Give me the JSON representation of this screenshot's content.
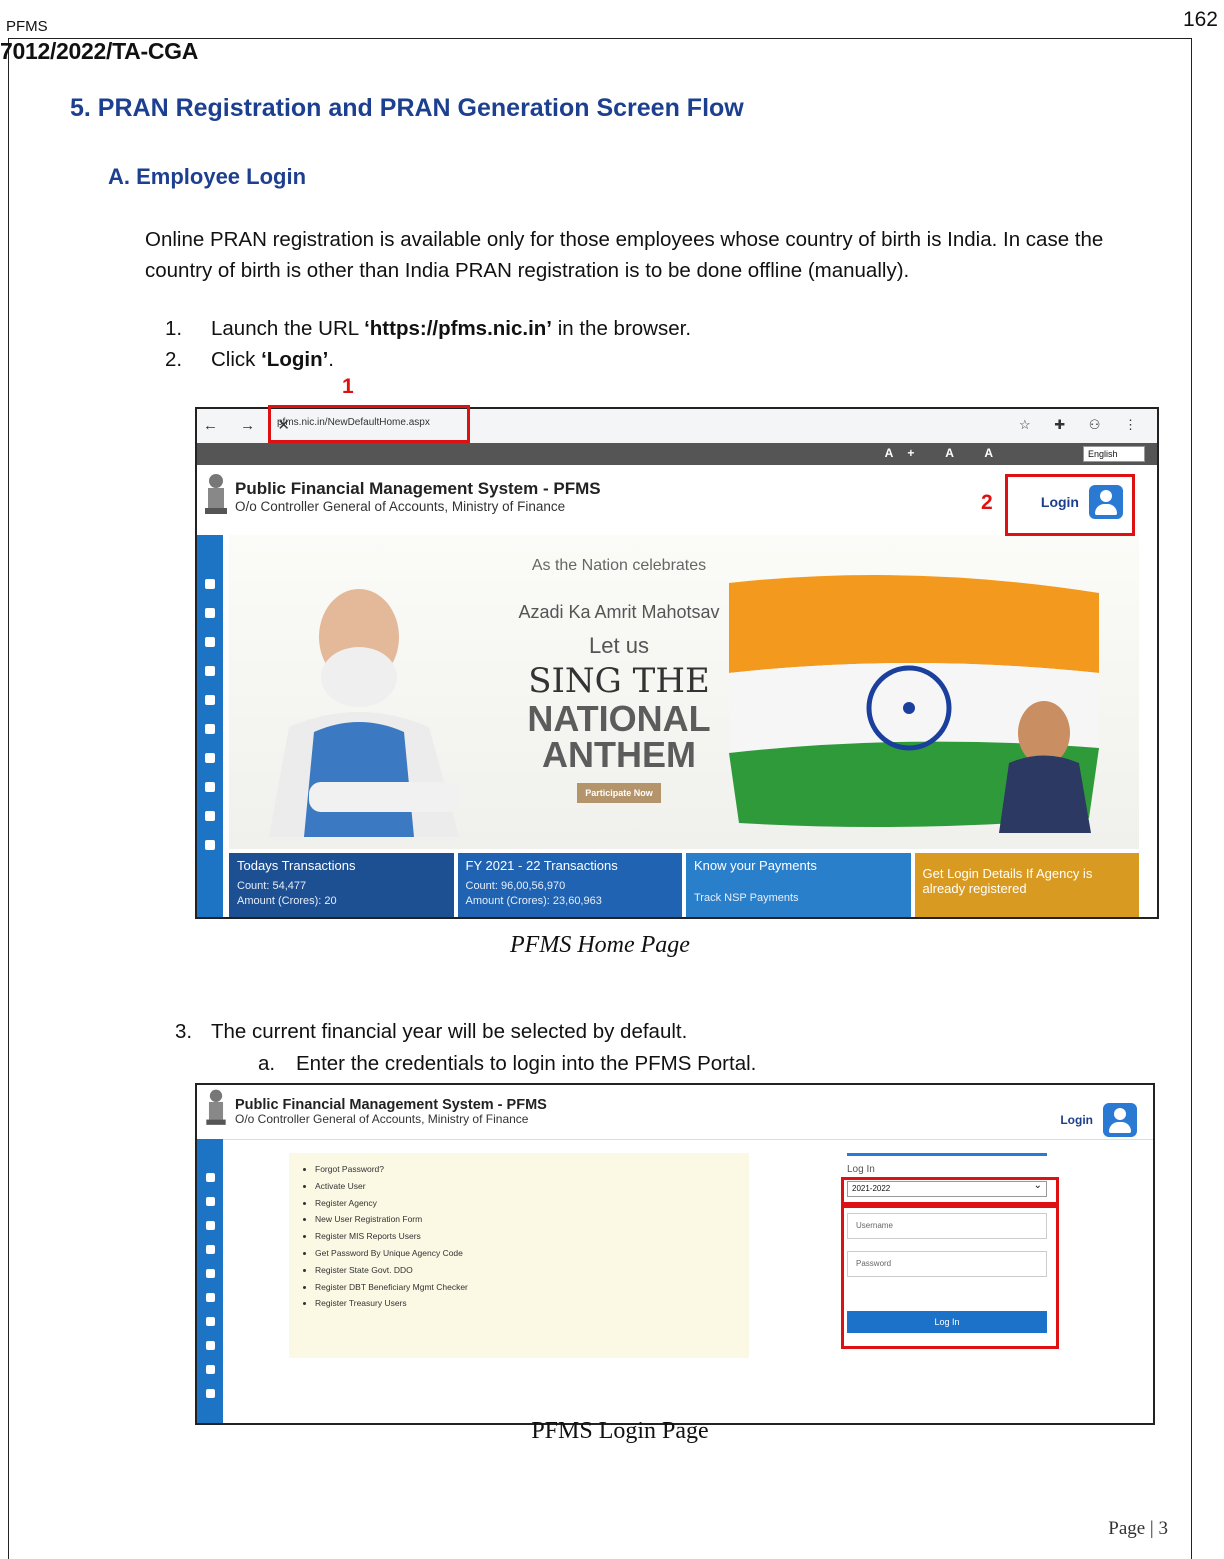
{
  "header": {
    "left": "PFMS",
    "ref": "7012/2022/TA-CGA",
    "page_number": "162"
  },
  "section": {
    "heading": "5.  PRAN Registration and PRAN Generation Screen Flow",
    "subheading": "A.  Employee Login",
    "intro": "Online PRAN registration is available only for those employees whose country of birth is India. In case the country of birth is other than India PRAN registration is to be done offline (manually).",
    "steps": [
      {
        "num": "1.",
        "pre": "Launch the URL ",
        "bold": "‘https://pfms.nic.in’",
        "post": " in the browser."
      },
      {
        "num": "2.",
        "pre": "Click ",
        "bold": "‘Login’",
        "post": "."
      },
      {
        "num": "3.",
        "pre": "The current financial year will be selected by default.",
        "bold": "",
        "post": ""
      }
    ],
    "substep": {
      "num": "a.",
      "text": "Enter the  credentials to login into the PFMS Portal."
    },
    "markers": [
      "1",
      "2"
    ]
  },
  "home_screenshot": {
    "url": "pfms.nic.in/NewDefaultHome.aspx",
    "nav_icons": "← → ✕",
    "browser_icons": "☆ ✚ ⚇ ⋮",
    "access_buttons": "A+ A A",
    "language": "English",
    "title": "Public Financial Management System - PFMS",
    "subtitle": "O/o Controller General of Accounts, Ministry of Finance",
    "login_label": "Login",
    "banner": {
      "line1": "As the Nation celebrates",
      "line2": "Azadi Ka Amrit Mahotsav",
      "line3": "Let us",
      "line4": "SING THE",
      "line5": "NATIONAL",
      "line6": "ANTHEM",
      "cta": "Participate Now"
    },
    "tiles": [
      {
        "title": "Todays Transactions",
        "l1": "Count: 54,477",
        "l2": "Amount (Crores): 20",
        "color": "#1d4f93"
      },
      {
        "title": "FY 2021 - 22 Transactions",
        "l1": "Count: 96,00,56,970",
        "l2": "Amount (Crores): 23,60,963",
        "color": "#1f63b2"
      },
      {
        "title": "Know your Payments",
        "l1": "",
        "l2": "Track NSP Payments",
        "color": "#2a7fcb"
      },
      {
        "title": "Get Login Details If Agency is already registered",
        "l1": "",
        "l2": "",
        "color": "#d99a22"
      }
    ],
    "caption": "PFMS Home Page"
  },
  "login_screenshot": {
    "title": "Public Financial Management System - PFMS",
    "subtitle": "O/o Controller General of Accounts, Ministry of Finance",
    "login_label": "Login",
    "links": [
      "Forgot Password?",
      "Activate User",
      "Register Agency",
      "New User Registration Form",
      "Register MIS Reports Users",
      "Get Password By Unique Agency Code",
      "Register State Govt. DDO",
      "Register DBT Beneficiary Mgmt Checker",
      "Register Treasury Users"
    ],
    "panel_title": "Log In",
    "financial_year": "2021-2022",
    "username_placeholder": "Username",
    "password_placeholder": "Password",
    "button": "Log In",
    "caption": "PFMS Login Page"
  },
  "footer": {
    "page": "Page | 3"
  }
}
